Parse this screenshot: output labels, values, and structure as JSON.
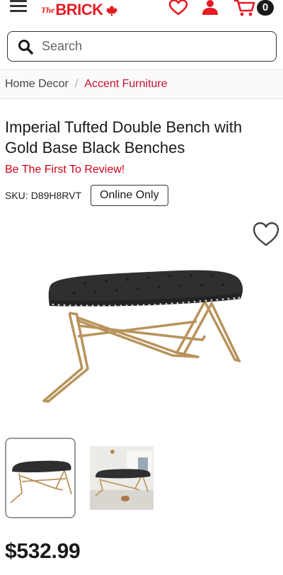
{
  "header": {
    "logo_the": "The",
    "logo_brick": "BRICK",
    "cart_count": "0",
    "colors": {
      "brand": "#e31b23",
      "dark": "#1a1a1a"
    },
    "icons": [
      "menu-icon",
      "maple-leaf-icon",
      "heart-icon",
      "user-icon",
      "cart-icon"
    ]
  },
  "search": {
    "placeholder": "Search",
    "value": ""
  },
  "breadcrumb": {
    "home": "Home Decor",
    "separator": "/",
    "current": "Accent Furniture"
  },
  "product": {
    "title": "Imperial Tufted Double Bench with Gold Base Black Benches",
    "review_link": "Be The First To Review!",
    "sku_label": "SKU:",
    "sku_value": "D89H8RVT",
    "availability": "Online Only",
    "price": "$532.99"
  },
  "gallery": {
    "thumbnail_count": 2,
    "selected_index": 0
  }
}
